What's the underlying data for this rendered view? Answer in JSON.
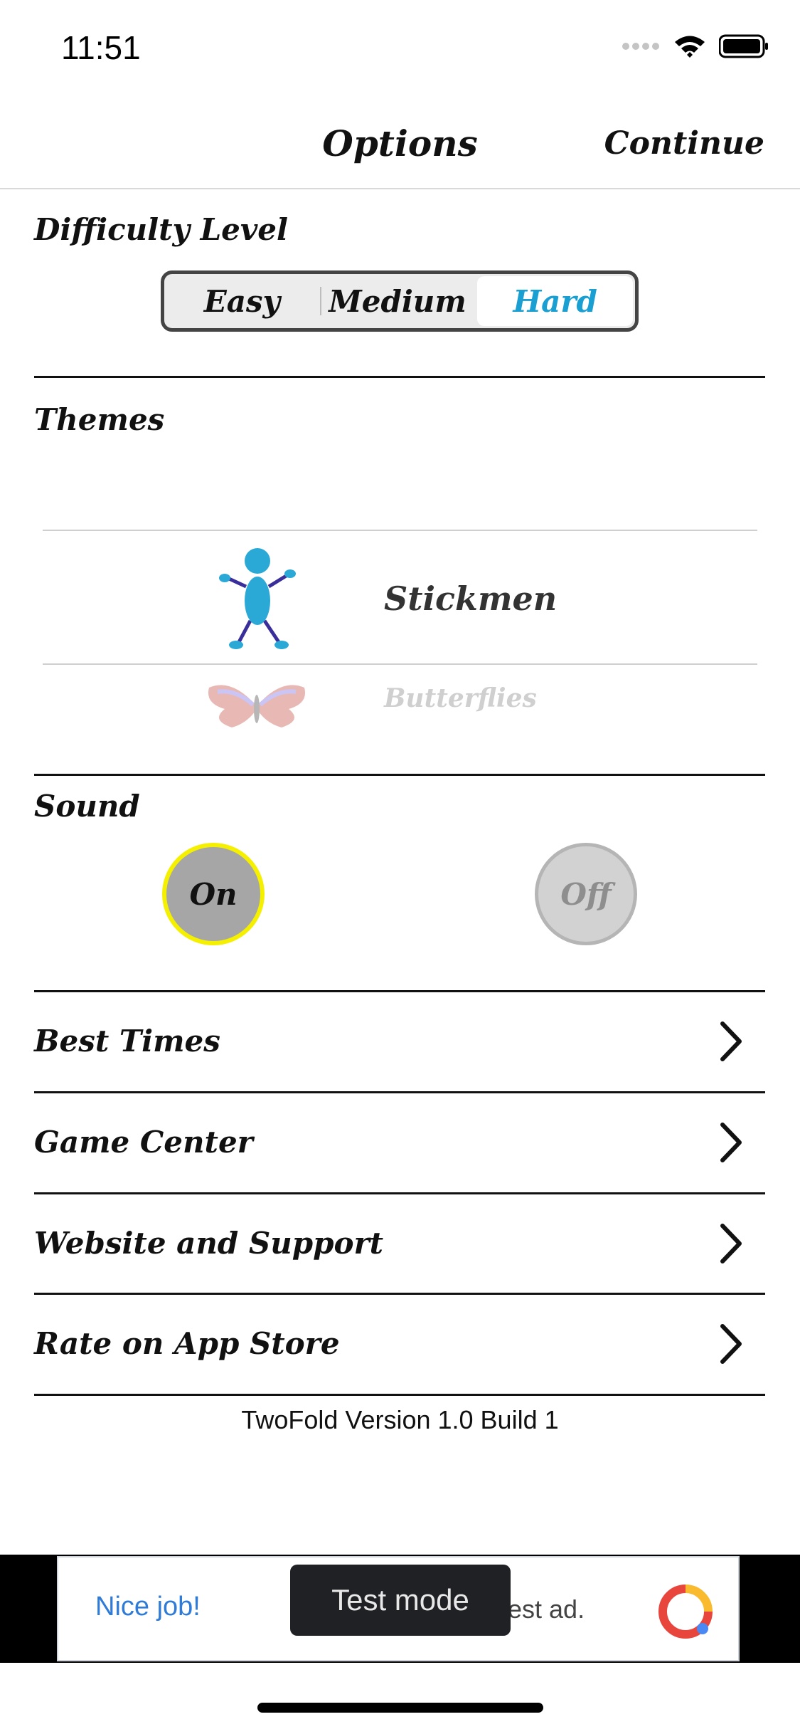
{
  "status_bar": {
    "time": "11:51",
    "icons": [
      "signal-icon",
      "wifi-icon",
      "battery-icon"
    ]
  },
  "nav": {
    "title": "Options",
    "continue_label": "Continue"
  },
  "difficulty": {
    "title": "Difficulty Level",
    "options": [
      "Easy",
      "Medium",
      "Hard"
    ],
    "selected": "Hard",
    "accent_color": "#1a9fd3"
  },
  "themes": {
    "title": "Themes",
    "items": [
      {
        "name": "Stickmen",
        "icon": "stickman-icon"
      },
      {
        "name": "Butterflies",
        "icon": "butterfly-icon"
      }
    ],
    "selected": "Stickmen"
  },
  "sound": {
    "title": "Sound",
    "on_label": "On",
    "off_label": "Off",
    "selected": "On",
    "highlight_color": "#f5ef00"
  },
  "menu": [
    {
      "label": "Best Times"
    },
    {
      "label": "Game Center"
    },
    {
      "label": "Website and Support"
    },
    {
      "label": "Rate on App Store"
    }
  ],
  "version": "TwoFold Version 1.0 Build 1",
  "ad": {
    "left_text": "Nice job!",
    "right_text": "est ad.",
    "toast": "Test mode"
  }
}
